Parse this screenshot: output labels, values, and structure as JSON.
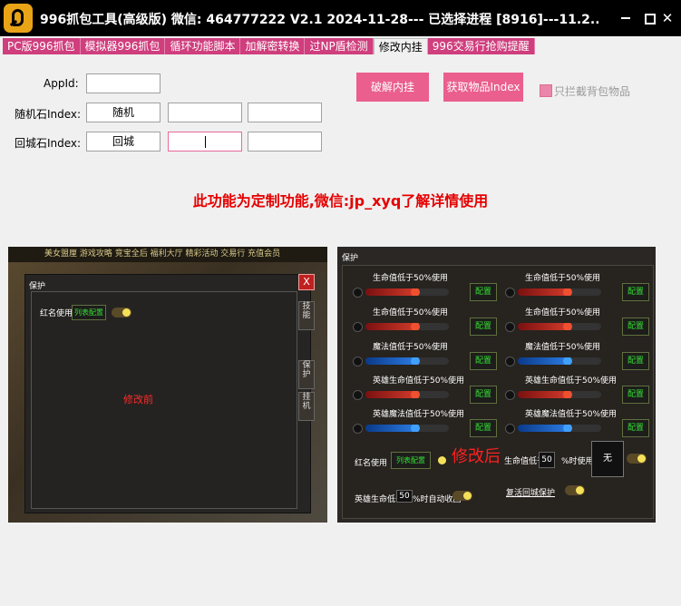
{
  "window": {
    "title": "996抓包工具(高级版) 微信: 464777222  V2.1  2024-11-28--- 已选择进程 [8916]---11.2...",
    "minimize_label": "",
    "maximize_label": "",
    "close_label": "✕"
  },
  "tabs": [
    {
      "label": "PC版996抓包",
      "active": false
    },
    {
      "label": "模拟器996抓包",
      "active": false
    },
    {
      "label": "循环功能脚本",
      "active": false
    },
    {
      "label": "加解密转换",
      "active": false
    },
    {
      "label": "过NP盾检测",
      "active": false
    },
    {
      "label": "修改内挂",
      "active": true
    },
    {
      "label": "996交易行抢购提醒",
      "active": false
    }
  ],
  "form": {
    "appid_label": "AppId:",
    "appid_value": "",
    "random_label": "随机石Index:",
    "random_name": "随机",
    "random_value1": "",
    "random_value2": "",
    "return_label": "回城石Index:",
    "return_name": "回城",
    "return_value1": "",
    "return_value2": ""
  },
  "buttons": {
    "crack": "破解内挂",
    "get_item_index": "获取物品Index"
  },
  "checkbox": {
    "label": "只拦截背包物品",
    "checked": false,
    "color": "#ea86aa"
  },
  "notice": "此功能为定制功能,微信:jp_xyq了解详情使用",
  "before_shot": {
    "game_menu": "美女盟厘  游戏攻略  竞宝全后  福利大厅  精彩活动  交易行  充值会员",
    "panel_title": "保护",
    "redname_label": "红名使用",
    "list_config": "列表配置",
    "caption": "修改前",
    "close_label": "X",
    "side_tabs": [
      "技能",
      "保护",
      "挂机"
    ]
  },
  "after_shot": {
    "panel_title": "保护",
    "rows": [
      {
        "left": "生命值低于50%使用",
        "right": "生命值低于50%使用",
        "type": "red",
        "level_left": 0.6,
        "level_right": 0.6
      },
      {
        "left": "生命值低于50%使用",
        "right": "生命值低于50%使用",
        "type": "red",
        "level_left": 0.6,
        "level_right": 0.6
      },
      {
        "left": "魔法值低于50%使用",
        "right": "魔法值低于50%使用",
        "type": "blue",
        "level_left": 0.6,
        "level_right": 0.6
      },
      {
        "left": "英雄生命值低于50%使用",
        "right": "英雄生命值低于50%使用",
        "type": "red",
        "level_left": 0.6,
        "level_right": 0.6
      },
      {
        "left": "英雄魔法值低于50%使用",
        "right": "英雄魔法值低于50%使用",
        "type": "blue",
        "level_left": 0.6,
        "level_right": 0.6
      }
    ],
    "config_label": "配置",
    "redname_label": "红名使用",
    "list_config": "列表配置",
    "caption": "修改后",
    "hp_below_label": "生命值低于",
    "hp_below_value": "50",
    "percent_use": "%时使用",
    "none_box": "无",
    "hero_hp_label": "英雄生命低于",
    "hero_hp_value": "50",
    "auto_recall": "%时自动收回",
    "restore_return": "复活回城保护"
  }
}
